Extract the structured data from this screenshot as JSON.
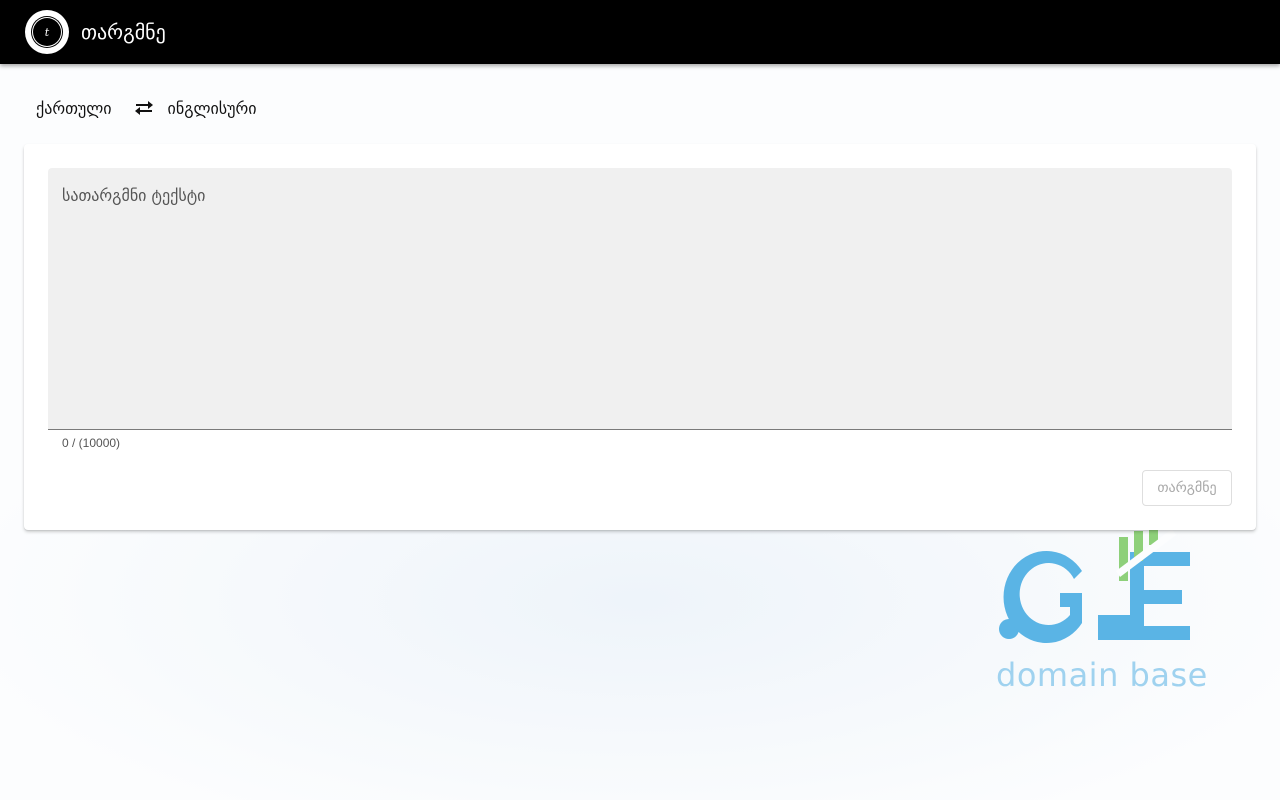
{
  "app": {
    "title": "თარგმნე",
    "logo_letter": "t"
  },
  "languages": {
    "source": "ქართული",
    "target": "ინგლისური",
    "swap_icon": "swap-horizontal-icon"
  },
  "editor": {
    "placeholder": "სათარგმნი ტექსტი",
    "value": "",
    "counter": "0 / (10000)"
  },
  "actions": {
    "translate_label": "თარგმნე"
  },
  "brand": {
    "mark": ".GE",
    "tagline": "domain base",
    "colors": {
      "blue": "#5ab4e5",
      "green": "#8ed07a",
      "tagline": "#9fd2ef"
    }
  }
}
